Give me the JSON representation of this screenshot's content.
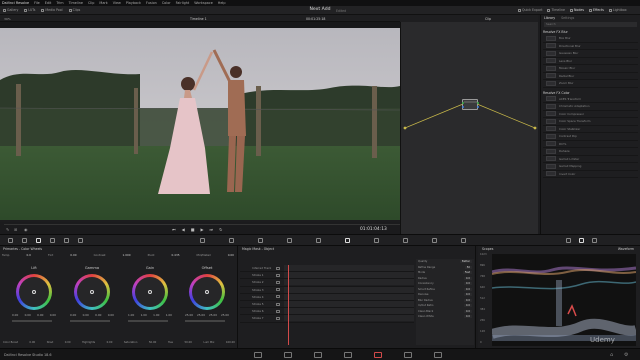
{
  "app": {
    "menu": [
      "DaVinci Resolve",
      "File",
      "Edit",
      "Trim",
      "Timeline",
      "Clip",
      "Mark",
      "View",
      "Playback",
      "Fusion",
      "Color",
      "Fairlight",
      "Workspace",
      "Help"
    ],
    "project_title": "Next Add",
    "project_sub": "Edited"
  },
  "toolbar": {
    "left": [
      "Gallery",
      "LUTs",
      "Media Pool",
      "Clips"
    ],
    "right": [
      "Quick Export",
      "Timeline",
      "Nodes",
      "Effects",
      "Lightbox"
    ]
  },
  "viewer": {
    "zoom": "39%",
    "timeline_name": "Timeline 1",
    "timecode_top": "00:01:25:18",
    "clip_label": "Clip",
    "timecode": "01:01:04:13"
  },
  "library": {
    "tab1": "Library",
    "tab2": "Settings",
    "search": "Search",
    "sections": [
      {
        "title": "Resolve FX Blur",
        "items": [
          "Box Blur",
          "Directional Blur",
          "Gaussian Blur",
          "Lens Blur",
          "Mosaic Blur",
          "Radial Blur",
          "Zoom Blur"
        ]
      },
      {
        "title": "Resolve FX Color",
        "items": [
          "ACES Transform",
          "Chromatic Adaptation",
          "Color Compressor",
          "Color Space Transform",
          "Color Stabilizer",
          "Contrast Pop",
          "DCTL",
          "Dehaze",
          "Gamut Limiter",
          "Gamut Mapping",
          "Invert Color"
        ]
      }
    ]
  },
  "primaries": {
    "title": "Primaries - Color Wheels",
    "temp_label": "Temp",
    "temp_value": "0.0",
    "tint_label": "Tint",
    "tint_value": "0.00",
    "contrast_label": "Contrast",
    "contrast_value": "1.000",
    "pivot_label": "Pivot",
    "pivot_value": "0.435",
    "middetail_label": "Mid/Detail",
    "middetail_value": "0.00",
    "wheels": [
      {
        "name": "Lift",
        "values": [
          "0.00",
          "0.00",
          "0.00",
          "0.00"
        ]
      },
      {
        "name": "Gamma",
        "values": [
          "0.00",
          "0.00",
          "0.00",
          "0.00"
        ]
      },
      {
        "name": "Gain",
        "values": [
          "1.00",
          "1.00",
          "1.00",
          "1.00"
        ]
      },
      {
        "name": "Offset",
        "values": [
          "25.00",
          "25.00",
          "25.00",
          "25.00"
        ]
      }
    ],
    "footer": [
      {
        "label": "Color Boost",
        "value": "0.00"
      },
      {
        "label": "Shad",
        "value": "0.00"
      },
      {
        "label": "Highlights",
        "value": "0.00"
      },
      {
        "label": "Saturation",
        "value": "50.00"
      },
      {
        "label": "Hue",
        "value": "50.00"
      },
      {
        "label": "Lum Mix",
        "value": "100.00"
      }
    ]
  },
  "magicmask": {
    "title": "Magic Mask - Object",
    "rows": [
      "Inferred Track",
      "Stroke 1",
      "Stroke 2",
      "Stroke 3",
      "Stroke 4",
      "Stroke 5",
      "Stroke 6",
      "Stroke 7"
    ],
    "tab_quality": "Quality",
    "tab_better": "Better",
    "params": [
      {
        "label": "Refine Range",
        "value": "50"
      },
      {
        "label": "Mode",
        "value": "Fast"
      },
      {
        "label": "Radius",
        "value": "0.0"
      },
      {
        "label": "Consistency",
        "value": "0.0"
      },
      {
        "label": "Smart Refine",
        "value": "0.0"
      },
      {
        "label": "Denoise",
        "value": "0.0"
      },
      {
        "label": "Blur Radius",
        "value": "0.0"
      },
      {
        "label": "In/Out Ratio",
        "value": "0.0"
      },
      {
        "label": "Clean Black",
        "value": "0.0"
      },
      {
        "label": "Clean White",
        "value": "0.0"
      }
    ]
  },
  "scopes": {
    "title": "Scopes",
    "mode": "Waveform",
    "scale": [
      "1023",
      "896",
      "768",
      "640",
      "512",
      "384",
      "256",
      "128",
      "0"
    ]
  },
  "bottom": {
    "app_name": "DaVinci Resolve Studio 18.6"
  },
  "colors": {
    "accent": "#d24a4a",
    "panel": "#1e1e20",
    "node_bg": "#2a2a2c"
  },
  "overlay": {
    "watermark": "Udemy"
  }
}
